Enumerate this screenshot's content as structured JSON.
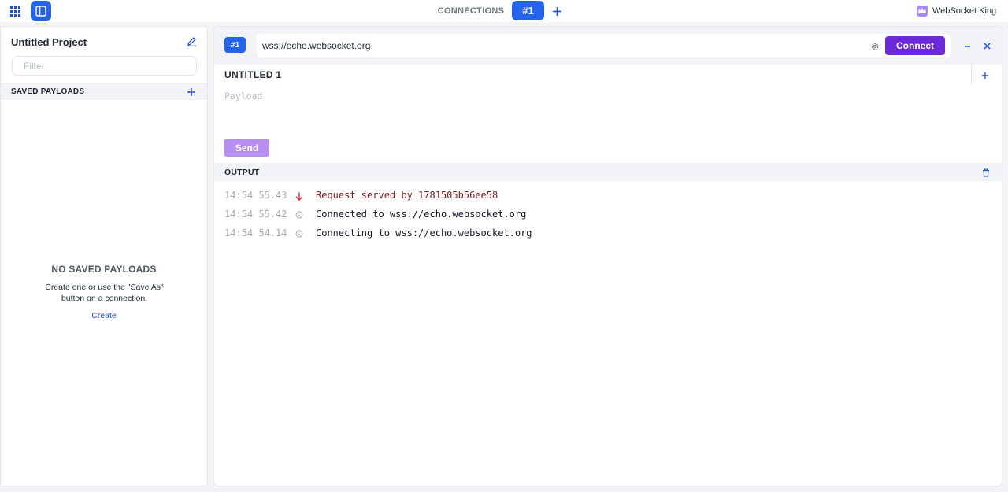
{
  "topbar": {
    "connections_label": "CONNECTIONS",
    "active_tab_label": "#1",
    "brand_name": "WebSocket King"
  },
  "sidebar": {
    "project_title": "Untitled Project",
    "filter_placeholder": "Filter",
    "saved_payloads_label": "SAVED PAYLOADS",
    "empty_title": "NO SAVED PAYLOADS",
    "empty_description": "Create one or use the \"Save As\" button on a connection.",
    "create_link": "Create"
  },
  "connection": {
    "badge": "#1",
    "url": "wss://echo.websocket.org",
    "connect_label": "Connect"
  },
  "payload": {
    "title": "UNTITLED 1",
    "placeholder": "Payload",
    "send_label": "Send"
  },
  "output": {
    "label": "OUTPUT",
    "logs": [
      {
        "time": "14:54 55.43",
        "direction": "incoming",
        "message": "Request served by 1781505b56ee58"
      },
      {
        "time": "14:54 55.42",
        "direction": "system",
        "message": "Connected to wss://echo.websocket.org"
      },
      {
        "time": "14:54 54.14",
        "direction": "system",
        "message": "Connecting to wss://echo.websocket.org"
      }
    ]
  },
  "colors": {
    "primary_blue": "#2563eb",
    "connect_purple": "#6d28d9",
    "send_purple_disabled": "#b78ff0",
    "incoming_arrow": "#dc2626",
    "incoming_text": "#7f1d1d"
  }
}
